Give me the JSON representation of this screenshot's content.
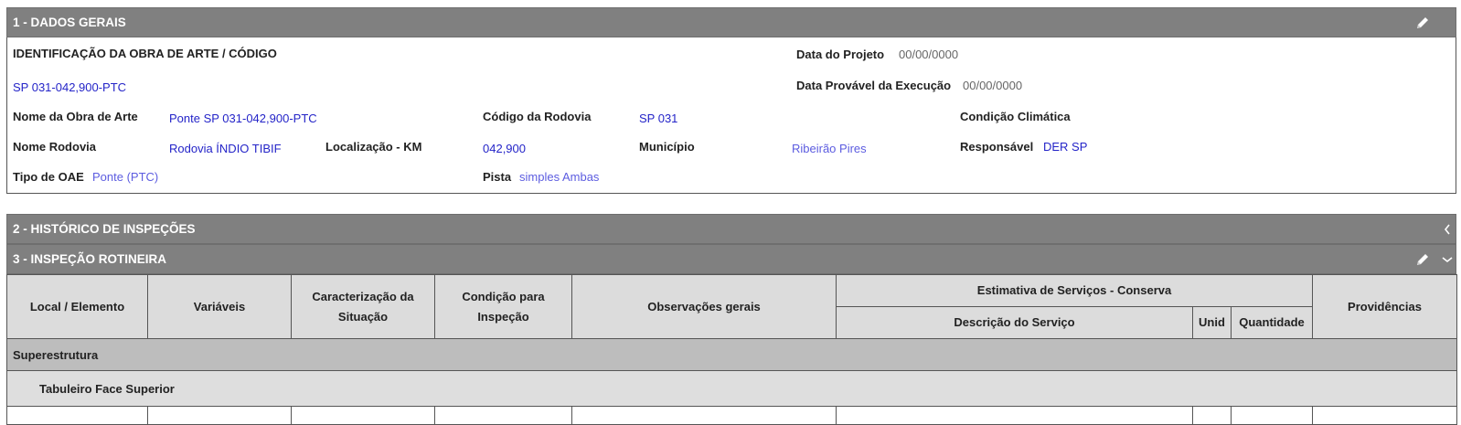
{
  "sections": {
    "dados_gerais": {
      "title": "1 - DADOS GERAIS"
    },
    "historico": {
      "title": "2 - HISTÓRICO DE INSPEÇÕES"
    },
    "rotineira": {
      "title": "3 - INSPEÇÃO ROTINEIRA"
    }
  },
  "general": {
    "identificacao_label": "IDENTIFICAÇÃO DA OBRA DE ARTE / CÓDIGO",
    "codigo_value": "SP 031-042,900-PTC",
    "data_projeto_label": "Data do Projeto",
    "data_projeto_value": "00/00/0000",
    "data_execucao_label": "Data Provável da Execução",
    "data_execucao_value": "00/00/0000",
    "nome_obra_label": "Nome da Obra de Arte",
    "nome_obra_value": "Ponte SP 031-042,900-PTC",
    "codigo_rodovia_label": "Código da Rodovia",
    "codigo_rodovia_value": "SP 031",
    "condicao_climatica_label": "Condição Climática",
    "nome_rodovia_label": "Nome Rodovia",
    "nome_rodovia_value": "Rodovia ÍNDIO TIBIF",
    "localizacao_label": "Localização - KM",
    "localizacao_value": "042,900",
    "municipio_label": "Município",
    "municipio_value": "Ribeirão Pires",
    "responsavel_label": "Responsável",
    "responsavel_value": "DER SP",
    "tipo_oae_label": "Tipo de OAE",
    "tipo_oae_value": "Ponte (PTC)",
    "pista_label": "Pista",
    "pista_value": "simples Ambas"
  },
  "table": {
    "headers": {
      "local": "Local / Elemento",
      "variaveis": "Variáveis",
      "caracterizacao": "Caracterização da Situação",
      "condicao": "Condição para Inspeção",
      "observacoes": "Observações gerais",
      "estimativa": "Estimativa de Serviços - Conserva",
      "descricao": "Descrição do Serviço",
      "unid": "Unid",
      "quantidade": "Quantidade",
      "providencias": "Providências"
    },
    "group": "Superestrutura",
    "subgroup": "Tabuleiro Face Superior"
  },
  "icons": {
    "edit": "pencil-icon",
    "collapse_left": "chevron-left-icon",
    "expand_down": "chevron-down-icon"
  },
  "colors": {
    "header_bg": "#808080",
    "link_value": "#2424c8",
    "table_header_bg": "#dcdcdc",
    "group_row_bg": "#bdbdbd"
  }
}
